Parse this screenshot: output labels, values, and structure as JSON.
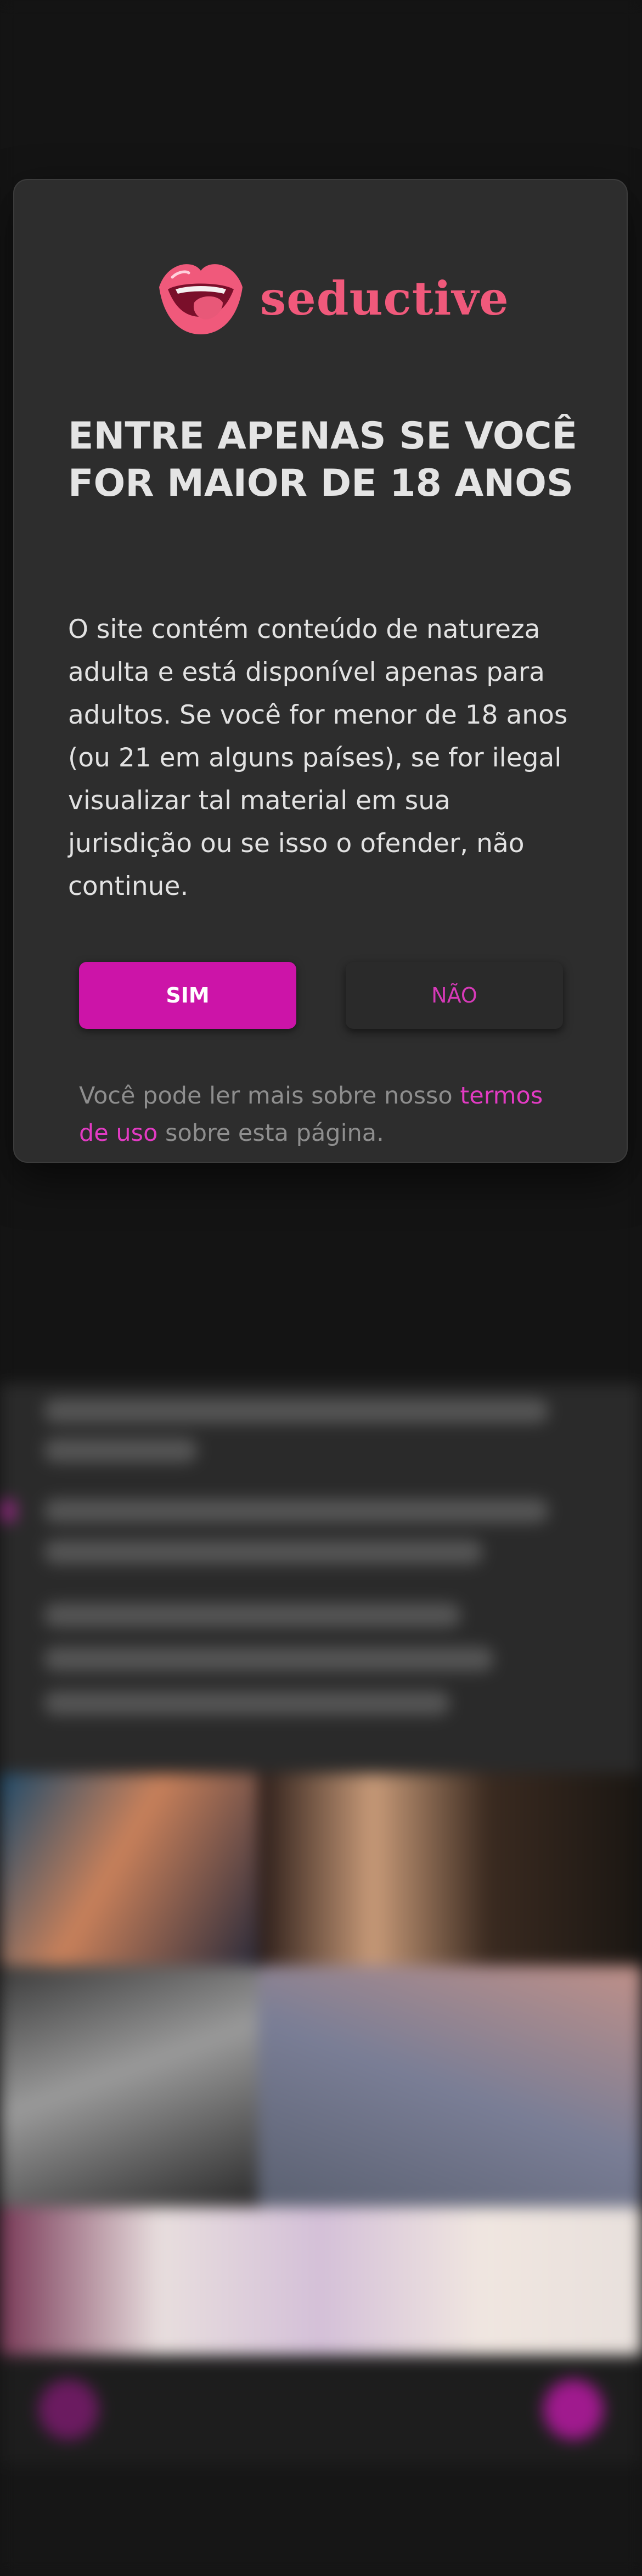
{
  "colors": {
    "page_background": "#131313",
    "modal_background": "#2d2d2d",
    "accent": "#cc14a8",
    "brand": "#f0597b",
    "link": "#e23bc3"
  },
  "logo": {
    "icon": "lips-icon",
    "text": "seductive"
  },
  "modal": {
    "heading": "ENTRE APENAS SE VOCÊ FOR MAIOR DE 18 ANOS",
    "body": "O site contém conteúdo de natureza adulta e está disponível apenas para adultos. Se você for menor de 18 anos (ou 21 em alguns países), se for ilegal visualizar tal material em sua jurisdição ou se isso o ofender, não continue.",
    "buttons": {
      "yes_label": "SIM",
      "no_label": "NÃO"
    },
    "footnote": {
      "before": "Você pode ler mais sobre nosso ",
      "link": "termos de uso",
      "after": " sobre esta página."
    }
  }
}
